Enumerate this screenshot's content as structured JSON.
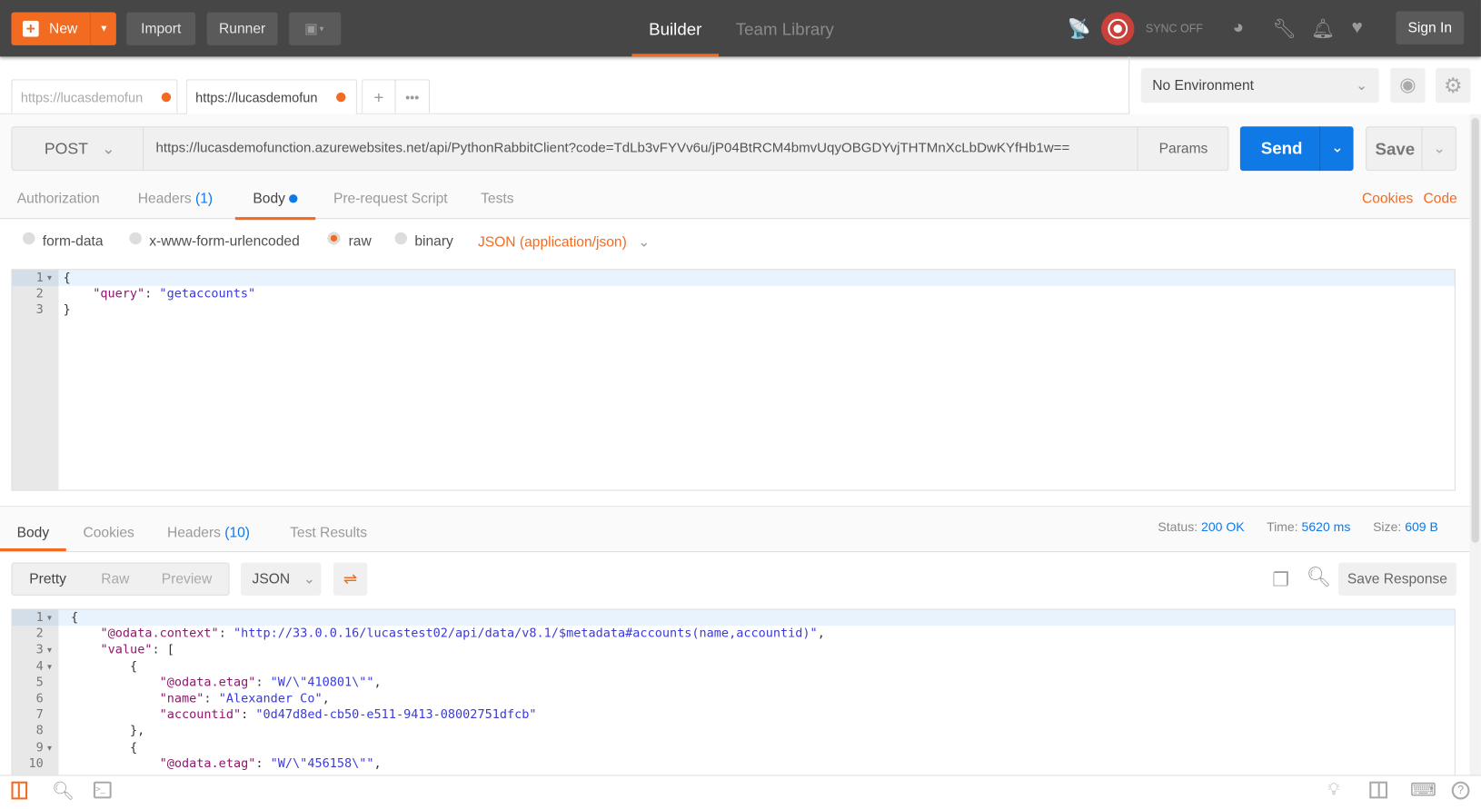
{
  "topbar": {
    "new_label": "New",
    "import_label": "Import",
    "runner_label": "Runner",
    "nav_tabs": [
      "Builder",
      "Team Library"
    ],
    "active_nav": "Builder",
    "sync_label": "SYNC OFF",
    "sign_in_label": "Sign In",
    "accent": "#f26b21"
  },
  "request_tabs": [
    {
      "label": "https://lucasdemofun",
      "unsaved": true
    },
    {
      "label": "https://lucasdemofun",
      "unsaved": true,
      "active": true
    }
  ],
  "environment": {
    "selected": "No Environment"
  },
  "request": {
    "method": "POST",
    "url": "https://lucasdemofunction.azurewebsites.net/api/PythonRabbitClient?code=TdLb3vFYVv6u/jP04BtRCM4bmvUqyOBGDYvjTHTMnXcLbDwKYfHb1w==",
    "params_label": "Params",
    "send_label": "Send",
    "save_label": "Save",
    "send_color": "#0f7ae5"
  },
  "request_subtabs": {
    "authorization": "Authorization",
    "headers": "Headers",
    "headers_count": "(1)",
    "body": "Body",
    "prerequest": "Pre-request Script",
    "tests": "Tests",
    "cookies": "Cookies",
    "code": "Code"
  },
  "body_modes": {
    "form_data": "form-data",
    "urlencoded": "x-www-form-urlencoded",
    "raw": "raw",
    "binary": "binary",
    "selected": "raw",
    "content_type": "JSON (application/json)"
  },
  "request_body": [
    {
      "num": "1",
      "fold": true,
      "tokens": [
        {
          "t": "{",
          "c": "p"
        }
      ]
    },
    {
      "num": "2",
      "tokens": [
        {
          "t": "    ",
          "c": "p"
        },
        {
          "t": "\"query\"",
          "c": "k"
        },
        {
          "t": ": ",
          "c": "p"
        },
        {
          "t": "\"getaccounts\"",
          "c": "s"
        }
      ]
    },
    {
      "num": "3",
      "tokens": [
        {
          "t": "}",
          "c": "p"
        }
      ]
    }
  ],
  "response": {
    "tabs": {
      "body": "Body",
      "cookies": "Cookies",
      "headers": "Headers",
      "headers_count": "(10)",
      "tests": "Test Results"
    },
    "status_label": "Status:",
    "status": "200 OK",
    "time_label": "Time:",
    "time": "5620 ms",
    "size_label": "Size:",
    "size": "609 B",
    "view_modes": [
      "Pretty",
      "Raw",
      "Preview"
    ],
    "active_view": "Pretty",
    "format": "JSON",
    "save_response_label": "Save Response"
  },
  "response_body": [
    {
      "num": "1",
      "fold": true,
      "tokens": [
        {
          "t": "{",
          "c": "p"
        }
      ]
    },
    {
      "num": "2",
      "tokens": [
        {
          "t": "    ",
          "c": "p"
        },
        {
          "t": "\"@odata.context\"",
          "c": "k"
        },
        {
          "t": ": ",
          "c": "p"
        },
        {
          "t": "\"http://33.0.0.16/lucastest02/api/data/v8.1/$metadata#accounts(name,accountid)\"",
          "c": "s"
        },
        {
          "t": ",",
          "c": "p"
        }
      ]
    },
    {
      "num": "3",
      "fold": true,
      "tokens": [
        {
          "t": "    ",
          "c": "p"
        },
        {
          "t": "\"value\"",
          "c": "k"
        },
        {
          "t": ": [",
          "c": "p"
        }
      ]
    },
    {
      "num": "4",
      "fold": true,
      "tokens": [
        {
          "t": "        {",
          "c": "p"
        }
      ]
    },
    {
      "num": "5",
      "tokens": [
        {
          "t": "            ",
          "c": "p"
        },
        {
          "t": "\"@odata.etag\"",
          "c": "k"
        },
        {
          "t": ": ",
          "c": "p"
        },
        {
          "t": "\"W/\\\"410801\\\"\"",
          "c": "s"
        },
        {
          "t": ",",
          "c": "p"
        }
      ]
    },
    {
      "num": "6",
      "tokens": [
        {
          "t": "            ",
          "c": "p"
        },
        {
          "t": "\"name\"",
          "c": "k"
        },
        {
          "t": ": ",
          "c": "p"
        },
        {
          "t": "\"Alexander Co\"",
          "c": "s"
        },
        {
          "t": ",",
          "c": "p"
        }
      ]
    },
    {
      "num": "7",
      "tokens": [
        {
          "t": "            ",
          "c": "p"
        },
        {
          "t": "\"accountid\"",
          "c": "k"
        },
        {
          "t": ": ",
          "c": "p"
        },
        {
          "t": "\"0d47d8ed-cb50-e511-9413-08002751dfcb\"",
          "c": "s"
        }
      ]
    },
    {
      "num": "8",
      "tokens": [
        {
          "t": "        },",
          "c": "p"
        }
      ]
    },
    {
      "num": "9",
      "fold": true,
      "tokens": [
        {
          "t": "        {",
          "c": "p"
        }
      ]
    },
    {
      "num": "10",
      "tokens": [
        {
          "t": "            ",
          "c": "p"
        },
        {
          "t": "\"@odata.etag\"",
          "c": "k"
        },
        {
          "t": ": ",
          "c": "p"
        },
        {
          "t": "\"W/\\\"456158\\\"\"",
          "c": "s"
        },
        {
          "t": ",",
          "c": "p"
        }
      ]
    }
  ]
}
